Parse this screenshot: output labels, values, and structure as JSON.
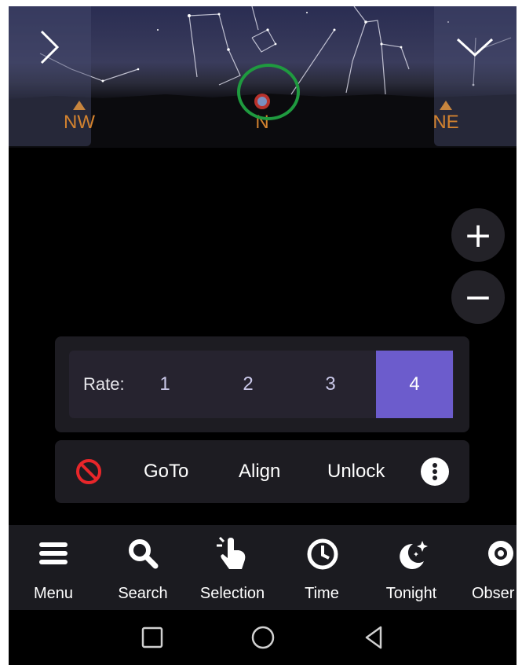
{
  "compass": {
    "left": "NW",
    "center": "N",
    "right": "NE"
  },
  "zoom": {
    "in_label": "+",
    "out_label": "−"
  },
  "rate": {
    "label": "Rate:",
    "options": [
      "1",
      "2",
      "3",
      "4"
    ],
    "selected": "4",
    "accent_color": "#6c5ccc"
  },
  "actions": {
    "goto_label": "GoTo",
    "align_label": "Align",
    "unlock_label": "Unlock",
    "stop_icon": "no-entry-icon",
    "more_icon": "more-vertical-icon"
  },
  "bottom_nav": {
    "items": [
      {
        "label": "Menu",
        "icon": "menu-icon"
      },
      {
        "label": "Search",
        "icon": "search-icon"
      },
      {
        "label": "Selection",
        "icon": "tap-hand-icon"
      },
      {
        "label": "Time",
        "icon": "clock-icon"
      },
      {
        "label": "Tonight",
        "icon": "moon-stars-icon"
      },
      {
        "label": "Obser",
        "icon": "eye-icon"
      }
    ]
  },
  "system_nav": [
    "recents-square-icon",
    "home-circle-icon",
    "back-triangle-icon"
  ],
  "colors": {
    "compass": "#d2822f",
    "highlight": "#1f9a3f"
  }
}
